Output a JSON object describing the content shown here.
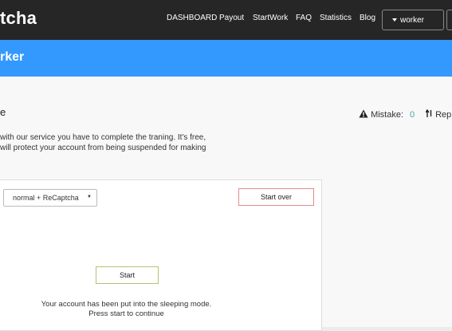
{
  "header": {
    "logo": "tcha",
    "nav": [
      "DASHBOARD",
      "Payout",
      "StartWork",
      "FAQ",
      "Statistics",
      "Blog"
    ],
    "user_label": "worker"
  },
  "banner": {
    "title": "rker"
  },
  "main": {
    "heading": "e",
    "description_lines": [
      "with our service you have to complete the traning. It's free,",
      "will protect your account from being suspended for making"
    ],
    "stats": {
      "mistake_label": "Mistake:",
      "mistake_value": "0",
      "rep_label": "Rep"
    }
  },
  "panel": {
    "mode_select": "normal + ReCaptcha",
    "start_over": "Start over",
    "start": "Start",
    "message_lines": [
      "Your account has been put into the sleeping mode.",
      "Press start to continue"
    ]
  },
  "colors": {
    "topbar": "#262626",
    "banner": "#3399ff",
    "stat_value": "#4aa8a0",
    "start_over_border": "#e48a8a",
    "start_border": "#b8c070"
  },
  "icons": {
    "mistake": "warning-icon",
    "rep": "sort-icon"
  }
}
